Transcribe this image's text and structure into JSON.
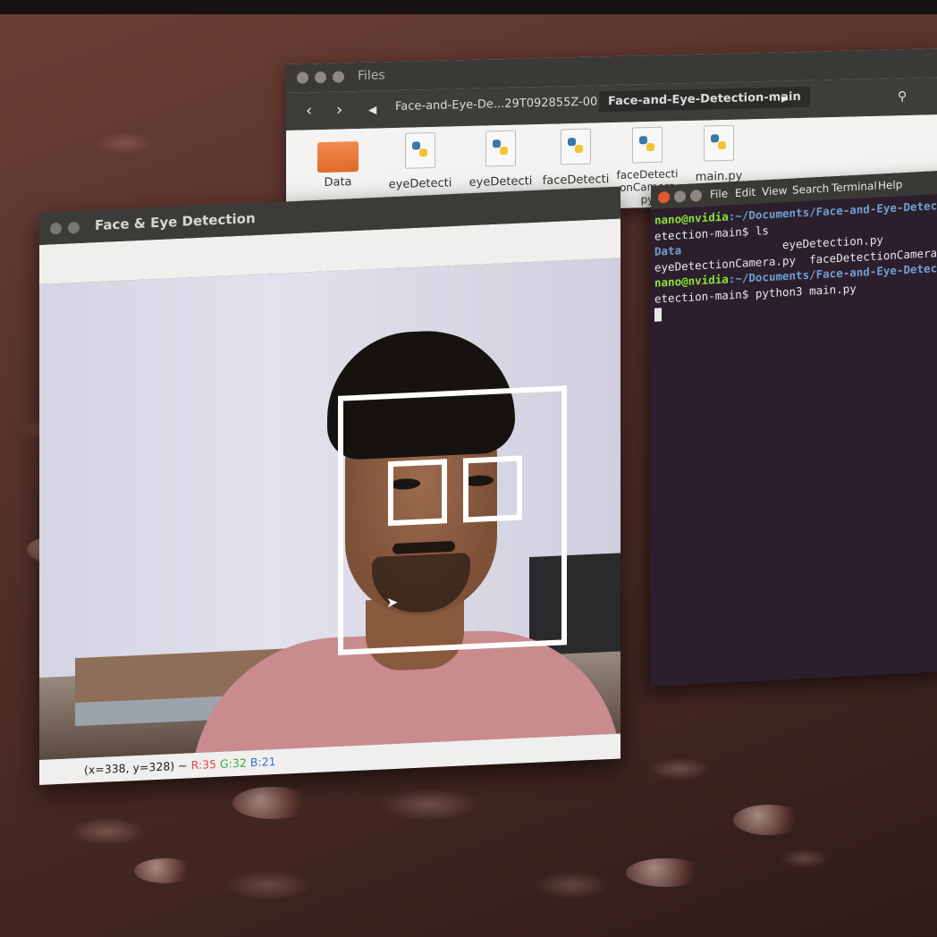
{
  "files_window": {
    "title": "Files",
    "breadcrumb_parent": "Face-and-Eye-De...29T092855Z-001",
    "breadcrumb_current": "Face-and-Eye-Detection-main",
    "items": [
      {
        "name": "Data",
        "icon": "folder-icon"
      },
      {
        "name": "eyeDetecti",
        "icon": "python-file-icon"
      },
      {
        "name": "eyeDetecti",
        "icon": "python-file-icon"
      },
      {
        "name": "faceDetecti",
        "icon": "python-file-icon"
      },
      {
        "name": "faceDetecti onCamera py",
        "icon": "python-file-icon"
      },
      {
        "name": "main.py",
        "icon": "python-file-icon"
      }
    ]
  },
  "terminal": {
    "menu": [
      "File",
      "Edit",
      "View",
      "Search",
      "Terminal",
      "Help"
    ],
    "lines": [
      {
        "user": "nano@nvidia",
        "path": ":~/Documents/Face-and-Eye-Detecti"
      },
      {
        "text": "etection-main$ ls"
      },
      {
        "dir": "Data",
        "text": "               eyeDetection.py"
      },
      {
        "text": "eyeDetectionCamera.py  faceDetectionCamera.py"
      },
      {
        "user": "nano@nvidia",
        "path": ":~/Documents/Face-and-Eye-Detecti"
      },
      {
        "text": "etection-main$ python3 main.py"
      }
    ]
  },
  "detection_window": {
    "title": "Face & Eye Detection",
    "status_coords": "(x=338, y=328) ~",
    "status_r": "R:35",
    "status_g": "G:32",
    "status_b": "B:21"
  }
}
